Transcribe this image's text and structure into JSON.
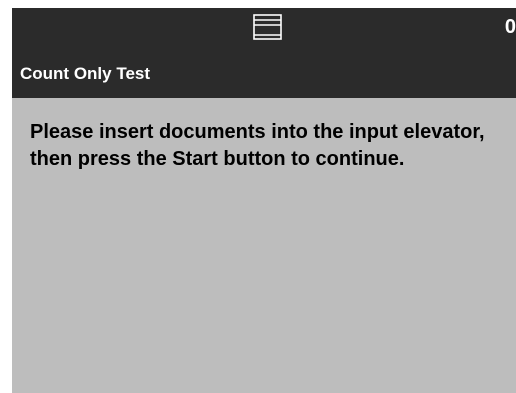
{
  "status_bar": {
    "icon": "feeder-tray-icon",
    "count": "0"
  },
  "header": {
    "title": "Count Only Test"
  },
  "main": {
    "message": "Please insert documents into the input elevator, then press the Start button to continue."
  },
  "colors": {
    "header_background": "#2b2b2b",
    "body_background": "#bdbdbd",
    "header_text": "#ffffff",
    "body_text": "#000000"
  }
}
